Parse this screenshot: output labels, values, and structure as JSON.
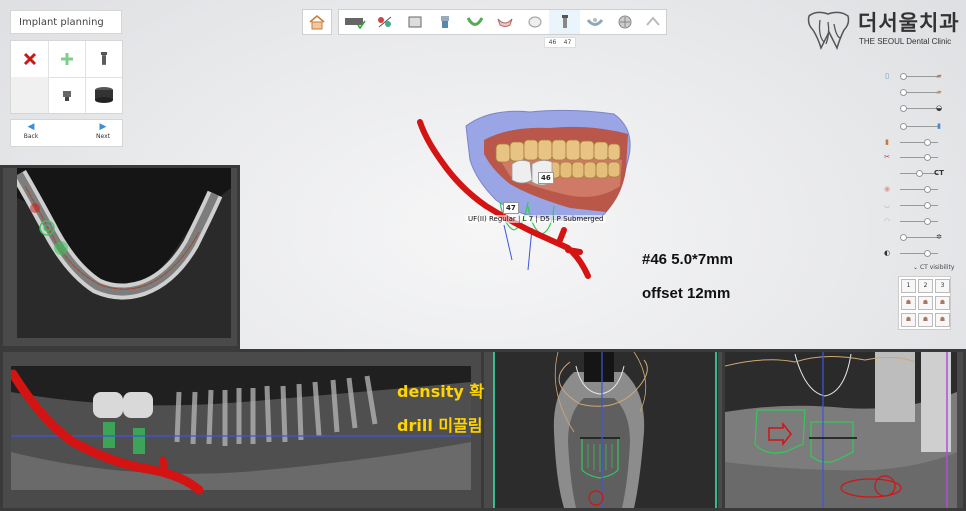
{
  "panel": {
    "title": "Implant planning",
    "tools": [
      {
        "name": "delete-implant",
        "icon": "red-x-icon"
      },
      {
        "name": "add-implant",
        "icon": "green-plus-icon"
      },
      {
        "name": "implant-fixture",
        "icon": "implant-screw-icon"
      },
      {
        "name": "empty",
        "icon": ""
      },
      {
        "name": "abutment",
        "icon": "abutment-icon"
      },
      {
        "name": "sleeve",
        "icon": "sleeve-icon"
      }
    ],
    "back_label": "Back",
    "next_label": "Next"
  },
  "toolbar": {
    "steps": [
      "ct-icon",
      "alignment-icon",
      "scan-icon",
      "tooth-icon",
      "arch-icon",
      "crown-icon",
      "tooth-wax-icon",
      "implant-icon",
      "guide-icon",
      "cutting-icon",
      "export-icon"
    ],
    "active_step": 7,
    "sub_tabs": [
      "46",
      "47"
    ]
  },
  "logo": {
    "korean": "더서울치과",
    "english": "THE SEOUL Dental Clinic"
  },
  "right_panel": {
    "ct_label": "CT",
    "ct_visibility_label": "CT visibility",
    "view_buttons": [
      "1",
      "2",
      "3"
    ]
  },
  "view3d": {
    "tooth_labels": [
      "46",
      "47"
    ],
    "implant_info": "UF(II) Regular | L 7 | D5 | P Submerged",
    "note_line1": "#46 5.0*7mm",
    "note_line2": "offset 12mm"
  },
  "panoramic": {
    "note_line1": "density 확인",
    "note_line2": "drill 미끌림 주의"
  },
  "colors": {
    "nerve": "#d41313",
    "implant": "#34c95a",
    "axis_blue": "#3d55e0",
    "note_yellow": "#ffd400",
    "accent": "#3a8fd6"
  }
}
